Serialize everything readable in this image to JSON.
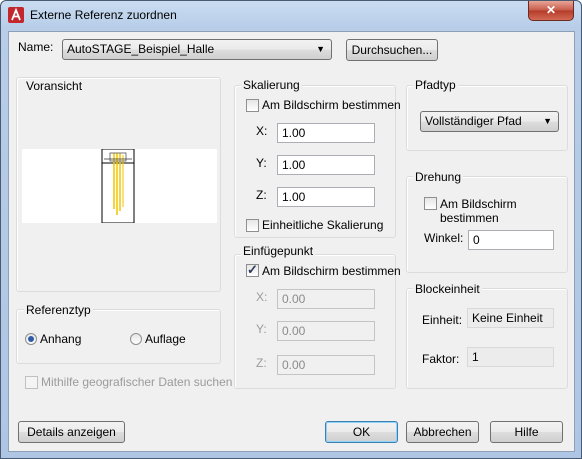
{
  "window": {
    "title": "Externe Referenz zuordnen",
    "close": "✕"
  },
  "name": {
    "label": "Name:",
    "value": "AutoSTAGE_Beispiel_Halle",
    "browse": "Durchsuchen..."
  },
  "preview": {
    "label": "Voransicht"
  },
  "scale": {
    "label": "Skalierung",
    "onscreen": "Am Bildschirm bestimmen",
    "x_label": "X:",
    "x": "1.00",
    "y_label": "Y:",
    "y": "1.00",
    "z_label": "Z:",
    "z": "1.00",
    "uniform": "Einheitliche Skalierung"
  },
  "insert": {
    "label": "Einfügepunkt",
    "onscreen": "Am Bildschirm bestimmen",
    "x_label": "X:",
    "x": "0.00",
    "y_label": "Y:",
    "y": "0.00",
    "z_label": "Z:",
    "z": "0.00"
  },
  "pathtype": {
    "label": "Pfadtyp",
    "value": "Vollständiger Pfad"
  },
  "rotation": {
    "label": "Drehung",
    "onscreen": "Am Bildschirm bestimmen",
    "angle_label": "Winkel:",
    "angle": "0"
  },
  "block": {
    "label": "Blockeinheit",
    "unit_label": "Einheit:",
    "unit": "Keine Einheit",
    "factor_label": "Faktor:",
    "factor": "1"
  },
  "reftype": {
    "label": "Referenztyp",
    "attach": "Anhang",
    "overlay": "Auflage"
  },
  "geo": {
    "label": "Mithilfe geografischer Daten suchen"
  },
  "buttons": {
    "details": "Details anzeigen",
    "ok": "OK",
    "cancel": "Abbrechen",
    "help": "Hilfe"
  },
  "colors": {
    "accent": "#3c7fb1",
    "title_gradient": "#c9dcf1",
    "close": "#c75848"
  },
  "icons": {
    "app": "autocad-logo-icon",
    "dropdown": "chevron-down-icon"
  }
}
